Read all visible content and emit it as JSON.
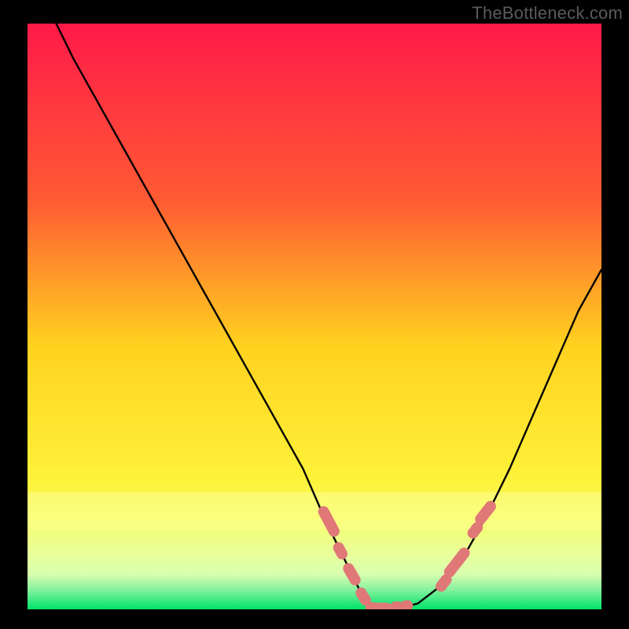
{
  "watermark": "TheBottleneck.com",
  "colors": {
    "gradient_top": "#ff1a49",
    "gradient_mid1": "#ff6e2c",
    "gradient_mid2": "#ffd21f",
    "gradient_mid3": "#f8f623",
    "gradient_bottom_pale": "#d9ffb0",
    "gradient_bottom": "#00e36a",
    "curve": "#000000",
    "marker_fill": "#e07878",
    "marker_stroke": "#d86a6a"
  },
  "chart_data": {
    "type": "line",
    "title": "",
    "xlabel": "",
    "ylabel": "",
    "xlim": [
      0,
      100
    ],
    "ylim": [
      0,
      100
    ],
    "series": [
      {
        "name": "bottleneck-curve",
        "x": [
          5,
          8,
          12,
          16,
          20,
          24,
          28,
          32,
          36,
          40,
          44,
          48,
          52,
          54,
          56,
          58,
          60,
          62,
          64,
          68,
          72,
          76,
          80,
          84,
          88,
          92,
          96,
          100
        ],
        "y": [
          100,
          94,
          87,
          80,
          73,
          66,
          59,
          52,
          45,
          38,
          31,
          24,
          15,
          11,
          7,
          3,
          0,
          0,
          0,
          1,
          4,
          9,
          16,
          24,
          33,
          42,
          51,
          58
        ]
      }
    ],
    "markers_left": [
      {
        "x": 52.5,
        "y": 15,
        "len": 5.5,
        "angle": 62
      },
      {
        "x": 54.5,
        "y": 10,
        "len": 3.0,
        "angle": 62
      },
      {
        "x": 56.5,
        "y": 6,
        "len": 4.0,
        "angle": 60
      },
      {
        "x": 58.5,
        "y": 2.2,
        "len": 3.2,
        "angle": 58
      }
    ],
    "markers_bottom": [
      {
        "x": 60.0,
        "y": 0.3,
        "len": 2.2,
        "angle": 5
      },
      {
        "x": 61.5,
        "y": 0.2,
        "len": 3.8,
        "angle": 0
      },
      {
        "x": 64.3,
        "y": 0.4,
        "len": 2.2,
        "angle": -5
      },
      {
        "x": 66.0,
        "y": 0.6,
        "len": 2.2,
        "angle": -12
      }
    ],
    "markers_right": [
      {
        "x": 72.5,
        "y": 4.5,
        "len": 3.2,
        "angle": -52
      },
      {
        "x": 74.8,
        "y": 8.0,
        "len": 5.8,
        "angle": -52
      },
      {
        "x": 78.0,
        "y": 13.5,
        "len": 3.0,
        "angle": -52
      },
      {
        "x": 79.8,
        "y": 16.5,
        "len": 4.5,
        "angle": -52
      }
    ]
  }
}
